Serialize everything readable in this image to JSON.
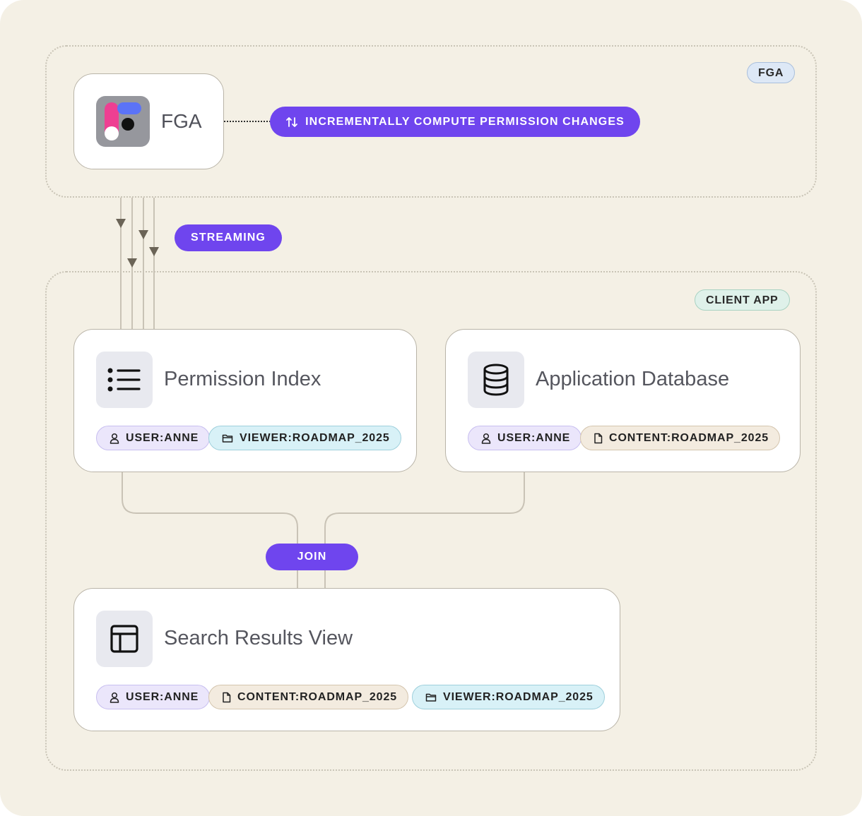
{
  "regions": {
    "fga": {
      "badge": "FGA"
    },
    "client_app": {
      "badge": "CLIENT APP"
    }
  },
  "fga_card": {
    "title": "FGA",
    "icon": "fga-logo"
  },
  "pills": {
    "compute": {
      "label": "INCREMENTALLY COMPUTE PERMISSION CHANGES",
      "icon": "swap-vertical-arrows-icon"
    },
    "streaming": {
      "label": "STREAMING"
    },
    "join": {
      "label": "JOIN"
    }
  },
  "permission_index": {
    "title": "Permission Index",
    "icon": "list-icon",
    "tags": [
      {
        "type": "user",
        "icon": "user-icon",
        "label": "USER:ANNE"
      },
      {
        "type": "viewer",
        "icon": "folder-icon",
        "label": "VIEWER:ROADMAP_2025"
      }
    ]
  },
  "application_database": {
    "title": "Application Database",
    "icon": "database-icon",
    "tags": [
      {
        "type": "user",
        "icon": "user-icon",
        "label": "USER:ANNE"
      },
      {
        "type": "content",
        "icon": "file-icon",
        "label": "CONTENT:ROADMAP_2025"
      }
    ]
  },
  "search_results_view": {
    "title": "Search Results View",
    "icon": "table-icon",
    "tags": [
      {
        "type": "user",
        "icon": "user-icon",
        "label": "USER:ANNE"
      },
      {
        "type": "content",
        "icon": "file-icon",
        "label": "CONTENT:ROADMAP_2025"
      },
      {
        "type": "viewer",
        "icon": "folder-icon",
        "label": "VIEWER:ROADMAP_2025"
      }
    ]
  },
  "colors": {
    "background": "#f4f0e5",
    "accent": "#6f45ee",
    "connector": "#c9c3b6",
    "arrow": "#6b6457"
  }
}
